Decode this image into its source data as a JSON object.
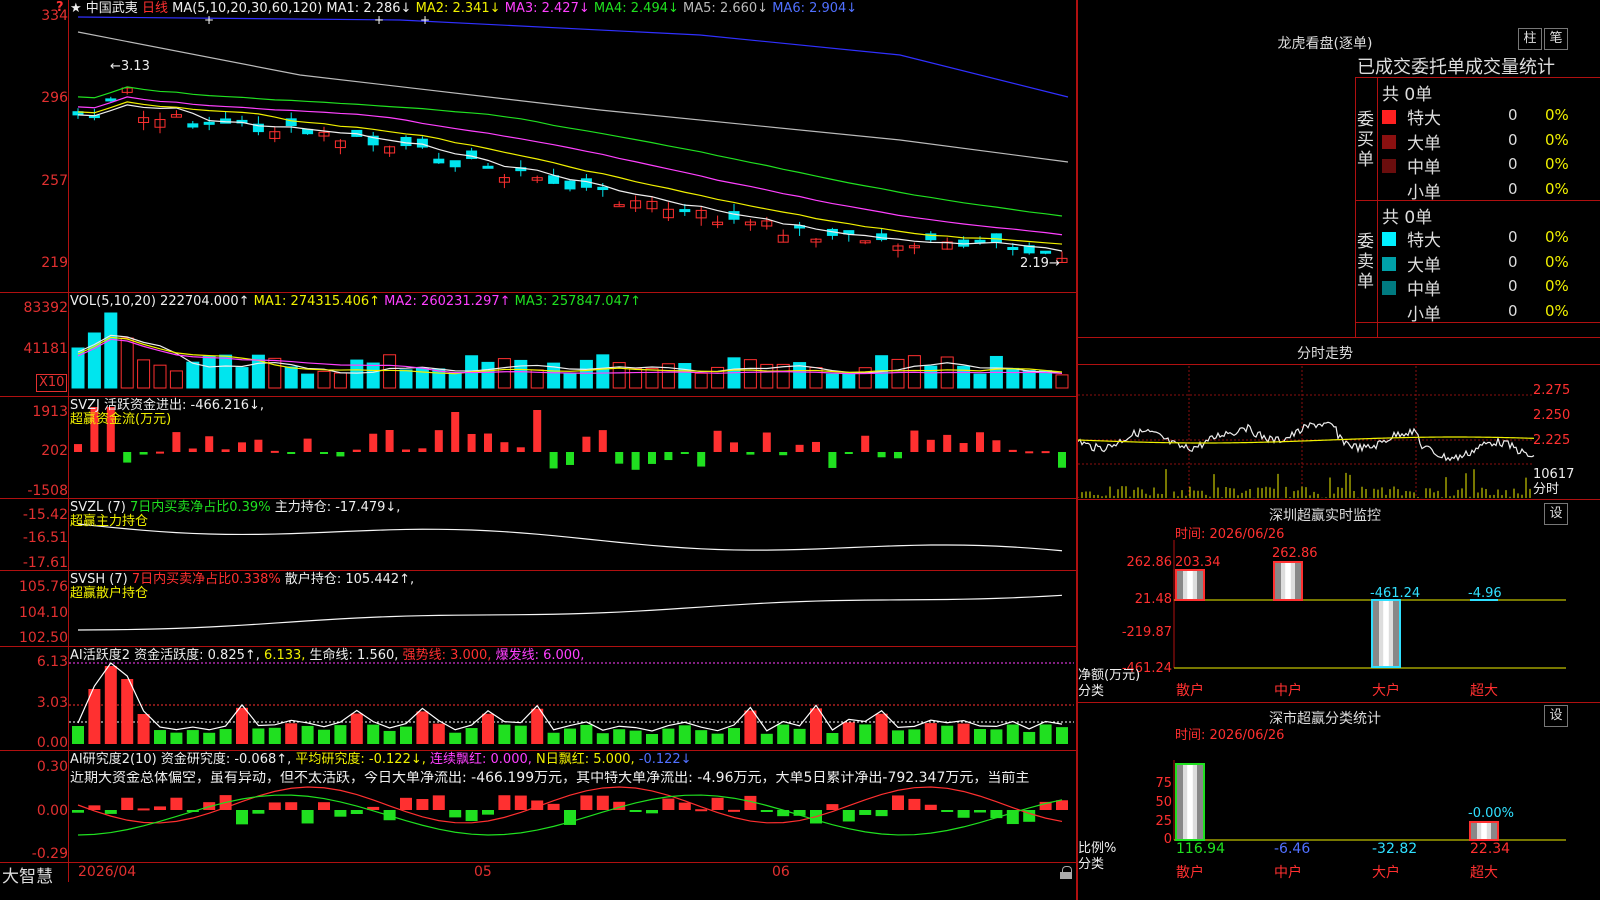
{
  "colors": {
    "up": "#ff3030",
    "down": "#00e5ee",
    "sep": "#b01010",
    "white": "#eeeeee",
    "yellow": "#f0f000",
    "magenta": "#ff40ff",
    "green": "#20e020",
    "blue": "#3030ff",
    "gray": "#bbbbbb"
  },
  "main": {
    "stock_name": "中国武夷",
    "period": "日线",
    "ma_spec": "MA(5,10,20,30,60,120)",
    "ma1": "MA1: 2.286↓",
    "ma2": "MA2: 2.341↓",
    "ma3": "MA3: 2.427↓",
    "ma4": "MA4: 2.494↓",
    "ma5": "MA5: 2.660↓",
    "ma6": "MA6: 2.904↓",
    "axis": [
      "334",
      "296",
      "257",
      "219"
    ],
    "high_mark": "3.13",
    "low_mark": "2.19"
  },
  "vol": {
    "title": "VOL(5,10,20)",
    "value": "222704.000↑",
    "ma1": "MA1: 274315.406↑",
    "ma2": "MA2: 260231.297↑",
    "ma3": "MA3: 257847.047↑",
    "axis": [
      "83392",
      "41181"
    ],
    "unit": "X10"
  },
  "svzj": {
    "title": "SVZJ",
    "text": "活跃资金进出: -466.216↓,",
    "sub": "超赢资金流(万元)",
    "axis": [
      "1913",
      "202",
      "-1508"
    ]
  },
  "svzl": {
    "title": "SVZL (7)",
    "pct": "7日内买卖净占比0.39%",
    "text": "主力持仓: -17.479↓,",
    "sub": "超赢主力持仓",
    "axis": [
      "-15.42",
      "-16.51",
      "-17.61"
    ]
  },
  "svsh": {
    "title": "SVSH (7)",
    "pct": "7日内买卖净占比0.338%",
    "text": "散户持仓: 105.442↑,",
    "sub": "超赢散户持仓",
    "axis": [
      "105.76",
      "104.10",
      "102.50"
    ]
  },
  "ai1": {
    "title": "AI活跃度2",
    "a": "资金活跃度: 0.825↑,",
    "b": "6.133,",
    "c": "生命线: 1.560,",
    "d": "强势线: 3.000,",
    "e": "爆发线: 6.000,",
    "axis": [
      "6.13",
      "3.03",
      "0.00"
    ]
  },
  "ai2": {
    "title": "AI研究度2(10)",
    "a": "资金研究度: -0.068↑,",
    "b": "平均研究度: -0.122↓,",
    "c": "连续飘红: 0.000,",
    "d": "N日飘红: 5.000,",
    "e": "-0.122↓",
    "comment": "近期大资金总体偏空，虽有异动，但不太活跃，今日大单净流出: -466.199万元，其中特大单净流出: -4.96万元，大单5日累计净出-792.347万元，当前主",
    "axis": [
      "0.30",
      "0.00",
      "-0.29"
    ]
  },
  "bottom": {
    "brand": "大智慧",
    "date": "2026/04",
    "m5": "05",
    "m6": "06"
  },
  "right": {
    "lhkp": "龙虎看盘(逐单)",
    "btn_bar": "柱",
    "btn_pen": "笔",
    "stats_title": "已成交委托单成交量统计",
    "buy_label": "委买单",
    "sell_label": "委卖单",
    "buy_total": "共 0单",
    "sell_total": "共 0单",
    "buy_rows": [
      {
        "label": "特大",
        "count": "0",
        "pct": "0%",
        "color": "#ff2020"
      },
      {
        "label": "大单",
        "count": "0",
        "pct": "0%",
        "color": "#8b1010"
      },
      {
        "label": "中单",
        "count": "0",
        "pct": "0%",
        "color": "#6a0d0d"
      },
      {
        "label": "小单",
        "count": "0",
        "pct": "0%",
        "color": ""
      }
    ],
    "sell_rows": [
      {
        "label": "特大",
        "count": "0",
        "pct": "0%",
        "color": "#00f0ff"
      },
      {
        "label": "大单",
        "count": "0",
        "pct": "0%",
        "color": "#00a0a8"
      },
      {
        "label": "中单",
        "count": "0",
        "pct": "0%",
        "color": "#007a80"
      },
      {
        "label": "小单",
        "count": "0",
        "pct": "0%",
        "color": ""
      }
    ],
    "fenshi_title": "分时走势",
    "fs_axis": [
      "2.275",
      "2.250",
      "2.225"
    ],
    "fs_vol": "10617",
    "fs_label": "分时",
    "monitor_title": "深圳超赢实时监控",
    "monitor_btn": "设",
    "monitor_time": "时间: 2026/06/26",
    "monitor_axis": [
      "262.86",
      "21.48",
      "-219.87",
      "-461.24"
    ],
    "monitor_bar_labels": [
      "203.34",
      "262.86",
      "-461.24",
      "-4.96"
    ],
    "monitor_cats": [
      "散户",
      "中户",
      "大户",
      "超大"
    ],
    "monitor_ylabel": "净额(万元)",
    "monitor_xlabel": "分类",
    "class_title": "深市超赢分类统计",
    "class_btn": "设",
    "class_time": "时间: 2026/06/26",
    "class_axis": [
      "75",
      "50",
      "25",
      "0"
    ],
    "class_values": [
      "116.94",
      "-6.46",
      "-32.82",
      "22.34"
    ],
    "class_top": "-0.00%",
    "class_ylabel": "比例%",
    "class_xlabel": "分类"
  }
}
